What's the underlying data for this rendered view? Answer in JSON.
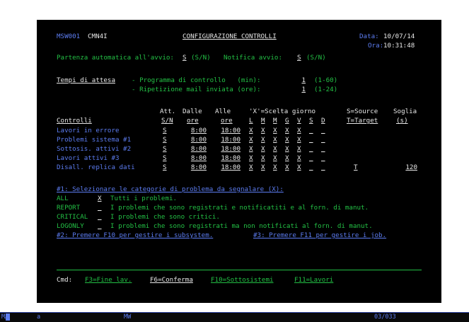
{
  "header": {
    "program": "MSW001",
    "lib": "CMN4I",
    "title": "CONFIGURAZIONE CONTROLLI",
    "date_label": "Data:",
    "date": "10/07/14",
    "time_label": "Ora:",
    "time": "10:31:48"
  },
  "startup": {
    "label": "Partenza automatica all'avvio:",
    "value": "S",
    "hint": "(S/N)",
    "notify_label": "Notifica avvio:",
    "notify_value": "S",
    "notify_hint": "(S/N)"
  },
  "wait": {
    "heading": "Tempi di attesa",
    "program_label": "- Programma di controllo   (min):",
    "program_value": "1",
    "program_hint": "(1-60)",
    "mail_label": "- Ripetizione mail inviata (ore):",
    "mail_value": "1",
    "mail_hint": "(1-24)"
  },
  "table": {
    "h1": [
      "Att.",
      "Dalle",
      "Alle",
      "'X'=Scelta giorno",
      "S=Source",
      "Soglia"
    ],
    "h2": [
      "Controlli",
      "S/N",
      "ore",
      "ore",
      "L",
      "M",
      "M",
      "G",
      "V",
      "S",
      "D",
      "T=Target",
      "(s)"
    ],
    "rows": [
      {
        "name": "Lavori in errore",
        "att": "S",
        "dalle": "8:00",
        "alle": "18:00",
        "days": [
          "X",
          "X",
          "X",
          "X",
          "X",
          "_",
          "_"
        ],
        "st": "",
        "soglia": ""
      },
      {
        "name": "Problemi sistema #1",
        "att": "S",
        "dalle": "8:00",
        "alle": "18:00",
        "days": [
          "X",
          "X",
          "X",
          "X",
          "X",
          "_",
          "_"
        ],
        "st": "",
        "soglia": ""
      },
      {
        "name": "Sottosis. attivi #2",
        "att": "S",
        "dalle": "8:00",
        "alle": "18:00",
        "days": [
          "X",
          "X",
          "X",
          "X",
          "X",
          "_",
          "_"
        ],
        "st": "",
        "soglia": ""
      },
      {
        "name": "Lavori attivi #3",
        "att": "S",
        "dalle": "8:00",
        "alle": "18:00",
        "days": [
          "X",
          "X",
          "X",
          "X",
          "X",
          "_",
          "_"
        ],
        "st": "",
        "soglia": ""
      },
      {
        "name": "Disall. replica dati",
        "att": "S",
        "dalle": "8:00",
        "alle": "18:00",
        "days": [
          "X",
          "X",
          "X",
          "X",
          "X",
          "_",
          "_"
        ],
        "st": "T",
        "soglia": "120"
      }
    ]
  },
  "notes": {
    "note1": "#1: Selezionare le categorie di problema da segnalare (X):",
    "options": [
      {
        "code": "ALL",
        "value": "X",
        "desc": "Tutti i problemi."
      },
      {
        "code": "REPORT",
        "value": "_",
        "desc": "I problemi che sono registrati e notificatiti e al forn. di manut."
      },
      {
        "code": "CRITICAL",
        "value": "_",
        "desc": "I problemi che sono critici."
      },
      {
        "code": "LOGONLY",
        "value": "_",
        "desc": "I problemi che sono registrati ma non notificati al forn. di manut."
      }
    ],
    "note2": "#2: Premere F10 per gestire i subsystem.",
    "note3": "#3: Premere F11 per gestire i job."
  },
  "commands": {
    "label": "Cmd:",
    "f3": "F3=Fine lav.",
    "f6": "F6=Conferma",
    "f10": "F10=Sottosistemi",
    "f11": "F11=Lavori"
  },
  "status": {
    "session": "MA",
    "mode": "a",
    "indicator": "MW",
    "position": "03/033"
  },
  "colors": {
    "green": "#23c045",
    "white": "#e8e8e8",
    "blue": "#5c7cf0",
    "background": "#000000"
  }
}
